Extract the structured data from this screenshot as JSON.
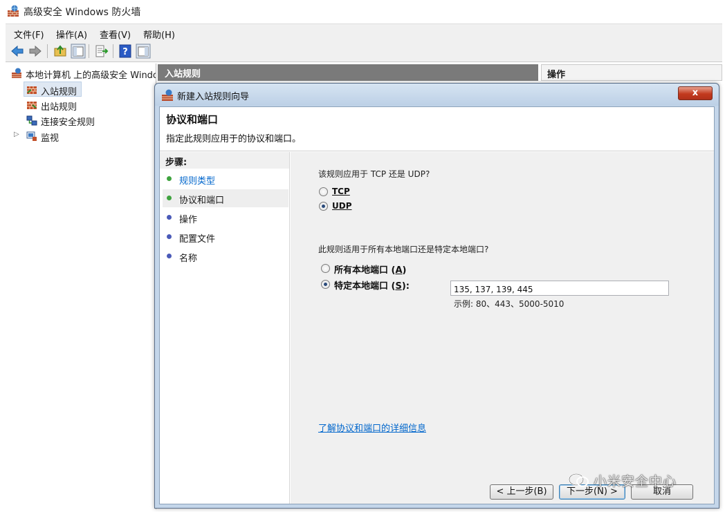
{
  "window": {
    "title": "高级安全 Windows 防火墙"
  },
  "menu": [
    "文件(F)",
    "操作(A)",
    "查看(V)",
    "帮助(H)"
  ],
  "toolbar_icons": [
    "back-icon",
    "forward-icon",
    "up-folder-icon",
    "show-hide-tree-icon",
    "export-list-icon",
    "help-icon",
    "show-hide-action-pane-icon"
  ],
  "tree": {
    "root": "本地计算机 上的高级安全 Windows 防火墙",
    "items": [
      "入站规则",
      "出站规则",
      "连接安全规则",
      "监视"
    ],
    "selected": "入站规则"
  },
  "center_header": "入站规则",
  "action_header": "操作",
  "dialog": {
    "title": "新建入站规则向导",
    "close_label": "x",
    "heading": "协议和端口",
    "subheading": "指定此规则应用于的协议和端口。",
    "steps_title": "步骤:",
    "steps": [
      {
        "label": "规则类型",
        "color": "#3fa33f",
        "link": true
      },
      {
        "label": "协议和端口",
        "color": "#3fa33f",
        "link": false
      },
      {
        "label": "操作",
        "color": "#4a5ab8",
        "link": false
      },
      {
        "label": "配置文件",
        "color": "#4a5ab8",
        "link": false
      },
      {
        "label": "名称",
        "color": "#4a5ab8",
        "link": false
      }
    ],
    "protocol_question": "该规则应用于 TCP 还是 UDP?",
    "protocol_options": [
      {
        "label": "TCP",
        "selected": false
      },
      {
        "label": "UDP",
        "selected": true
      }
    ],
    "port_question": "此规则适用于所有本地端口还是特定本地端口?",
    "port_options": [
      {
        "label": "所有本地端口",
        "key": "A",
        "selected": false
      },
      {
        "label": "特定本地端口",
        "key": "S",
        "selected": true
      }
    ],
    "ports_value": "135, 137, 139, 445",
    "example": "示例: 80、443、5000-5010",
    "help_link": "了解协议和端口的详细信息",
    "back_button": "< 上一步(B)",
    "next_button": "下一步(N) >",
    "cancel_button": "取消"
  },
  "watermark": "小米安全中心",
  "colors": {
    "accent": "#0066cc",
    "title_gradient": "#bcd0e6",
    "close": "#c23a1e"
  }
}
